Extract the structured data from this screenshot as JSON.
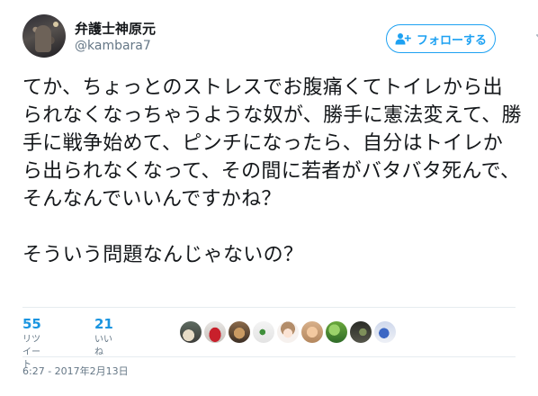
{
  "user": {
    "display_name": "弁護士神原元",
    "handle": "@kambara7"
  },
  "follow_button": {
    "label": "フォローする"
  },
  "tweet": {
    "text": "てか、ちょっとのストレスでお腹痛くてトイレから出られなくなっちゃうような奴が、勝手に憲法変えて、勝手に戦争始めて、ピンチになったら、自分はトイレから出られなくなって、その間に若者がバタバタ死んで、そんなんでいいんですかね？\n\nそういう問題なんじゃないの？"
  },
  "stats": {
    "retweets": {
      "count": "55",
      "label": "リツイート"
    },
    "likes": {
      "count": "21",
      "label": "いいね"
    }
  },
  "likers": [
    {
      "icon": "liker-avatar-cats"
    },
    {
      "icon": "liker-avatar-red-car"
    },
    {
      "icon": "liker-avatar-cat"
    },
    {
      "icon": "liker-avatar-green"
    },
    {
      "icon": "liker-avatar-anime-girl"
    },
    {
      "icon": "liker-avatar-face"
    },
    {
      "icon": "liker-avatar-plant"
    },
    {
      "icon": "liker-avatar-dark"
    },
    {
      "icon": "liker-avatar-blue"
    }
  ],
  "timestamp": "6:27 - 2017年2月13日",
  "colors": {
    "accent": "#1da1f2",
    "stat_number": "#1b95e0",
    "secondary_text": "#657786"
  }
}
